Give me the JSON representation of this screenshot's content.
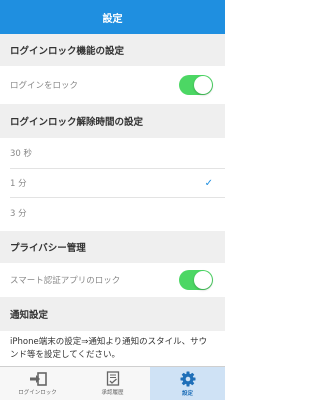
{
  "header": {
    "title": "設定"
  },
  "sections": {
    "login_lock": {
      "title": "ログインロック機能の設定",
      "toggle_label": "ログインをロック",
      "toggle_on": true
    },
    "unlock_time": {
      "title": "ログインロック解除時間の設定",
      "options": [
        "30 秒",
        "1 分",
        "3 分"
      ],
      "selected_index": 1
    },
    "privacy": {
      "title": "プライバシー管理",
      "toggle_label": "スマート認証アプリのロック",
      "toggle_on": true
    },
    "notification": {
      "title": "通知設定",
      "description": "iPhone端末の設定⇒通知より通知のスタイル、サウンド等を設定してください。"
    }
  },
  "tabs": [
    {
      "label": "ログインロック",
      "icon": "login-icon",
      "active": false
    },
    {
      "label": "承認履歴",
      "icon": "history-icon",
      "active": false
    },
    {
      "label": "設定",
      "icon": "gear-icon",
      "active": true
    }
  ],
  "colors": {
    "accent": "#1f8fe0",
    "toggle_on": "#4cd764",
    "section_bg": "#efefef",
    "active_tab_bg": "#cfe2f5"
  }
}
